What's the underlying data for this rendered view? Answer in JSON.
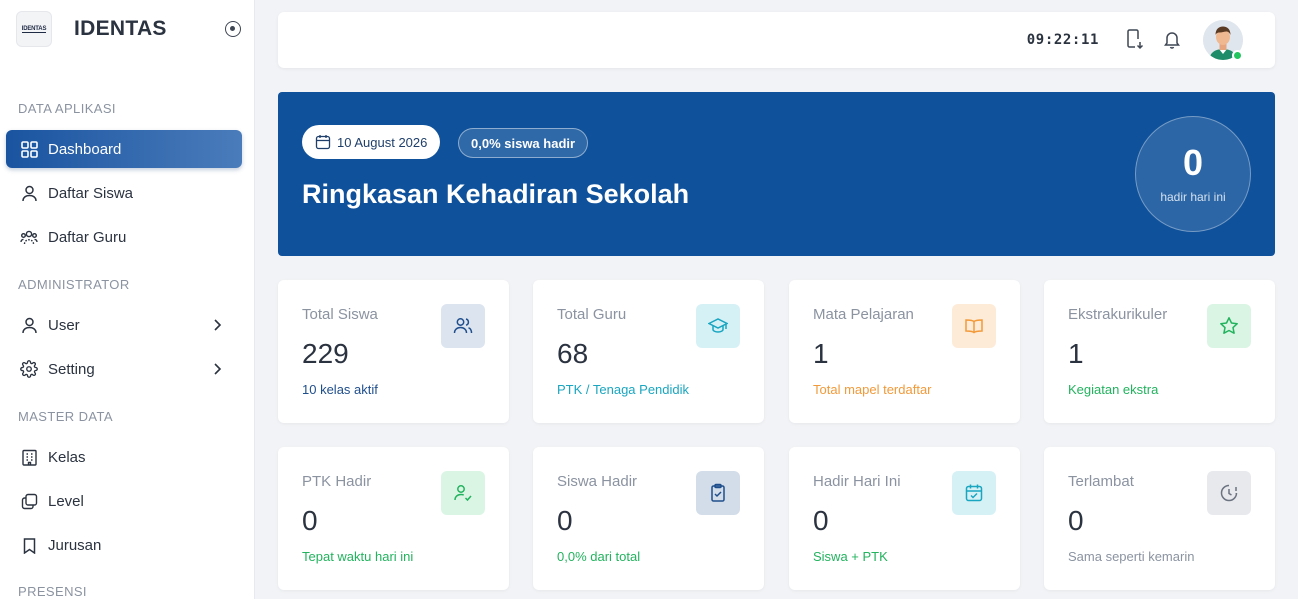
{
  "brand": {
    "logo_text": "IDENTAS",
    "name": "IDENTAS"
  },
  "sidebar": {
    "sections": [
      {
        "title": "DATA APLIKASI"
      },
      {
        "title": "ADMINISTRATOR"
      },
      {
        "title": "MASTER DATA"
      },
      {
        "title": "PRESENSI"
      }
    ],
    "items": [
      {
        "label": "Dashboard",
        "icon": "grid-icon",
        "active": true
      },
      {
        "label": "Daftar Siswa",
        "icon": "user-icon"
      },
      {
        "label": "Daftar Guru",
        "icon": "users-icon"
      },
      {
        "label": "User",
        "icon": "user-icon",
        "has_submenu": true
      },
      {
        "label": "Setting",
        "icon": "gear-icon",
        "has_submenu": true
      },
      {
        "label": "Kelas",
        "icon": "building-icon"
      },
      {
        "label": "Level",
        "icon": "layers-icon"
      },
      {
        "label": "Jurusan",
        "icon": "bookmark-icon"
      }
    ]
  },
  "topbar": {
    "time": "09:22:11",
    "icons": [
      "device-download-icon",
      "bell-icon",
      "avatar"
    ],
    "status_color": "#22c55e"
  },
  "hero": {
    "date": "10 August 2026",
    "rate": "0,0% siswa hadir",
    "title": "Ringkasan Kehadiran Sekolah",
    "count": "0",
    "count_label": "hadir hari ini",
    "background": "#0f519a"
  },
  "cards": [
    {
      "title": "Total Siswa",
      "value": "229",
      "sub": "10 kelas aktif",
      "sub_color": "#1f4e8c",
      "icon": "users-icon",
      "icon_bg": "#dbe4ef",
      "icon_color": "#1f4e8c"
    },
    {
      "title": "Total Guru",
      "value": "68",
      "sub": "PTK / Tenaga Pendidik",
      "sub_color": "#19a6c0",
      "icon": "graduation-cap-icon",
      "icon_bg": "#d6f1f6",
      "icon_color": "#19a6c0"
    },
    {
      "title": "Mata Pelajaran",
      "value": "1",
      "sub": "Total mapel terdaftar",
      "sub_color": "#f29a3a",
      "icon": "book-icon",
      "icon_bg": "#fdebd8",
      "icon_color": "#f29a3a"
    },
    {
      "title": "Ekstrakurikuler",
      "value": "1",
      "sub": "Kegiatan ekstra",
      "sub_color": "#22b35e",
      "icon": "star-icon",
      "icon_bg": "#dbf5e5",
      "icon_color": "#22b35e"
    },
    {
      "title": "PTK Hadir",
      "value": "0",
      "sub": "Tepat waktu hari ini",
      "sub_color": "#22b35e",
      "icon": "user-check-icon",
      "icon_bg": "#dbf5e5",
      "icon_color": "#22b35e"
    },
    {
      "title": "Siswa Hadir",
      "value": "0",
      "sub": "0,0% dari total",
      "sub_color": "#22b35e",
      "icon": "clipboard-check-icon",
      "icon_bg": "#d3dde9",
      "icon_color": "#1f4e8c"
    },
    {
      "title": "Hadir Hari Ini",
      "value": "0",
      "sub": "Siswa + PTK",
      "sub_color": "#22b35e",
      "icon": "calendar-check-icon",
      "icon_bg": "#d6f1f6",
      "icon_color": "#19a6c0"
    },
    {
      "title": "Terlambat",
      "value": "0",
      "sub": "Sama seperti kemarin",
      "sub_color": "#8b93a1",
      "icon": "clock-alert-icon",
      "icon_bg": "#e7e9ec",
      "icon_color": "#6b7280"
    }
  ]
}
